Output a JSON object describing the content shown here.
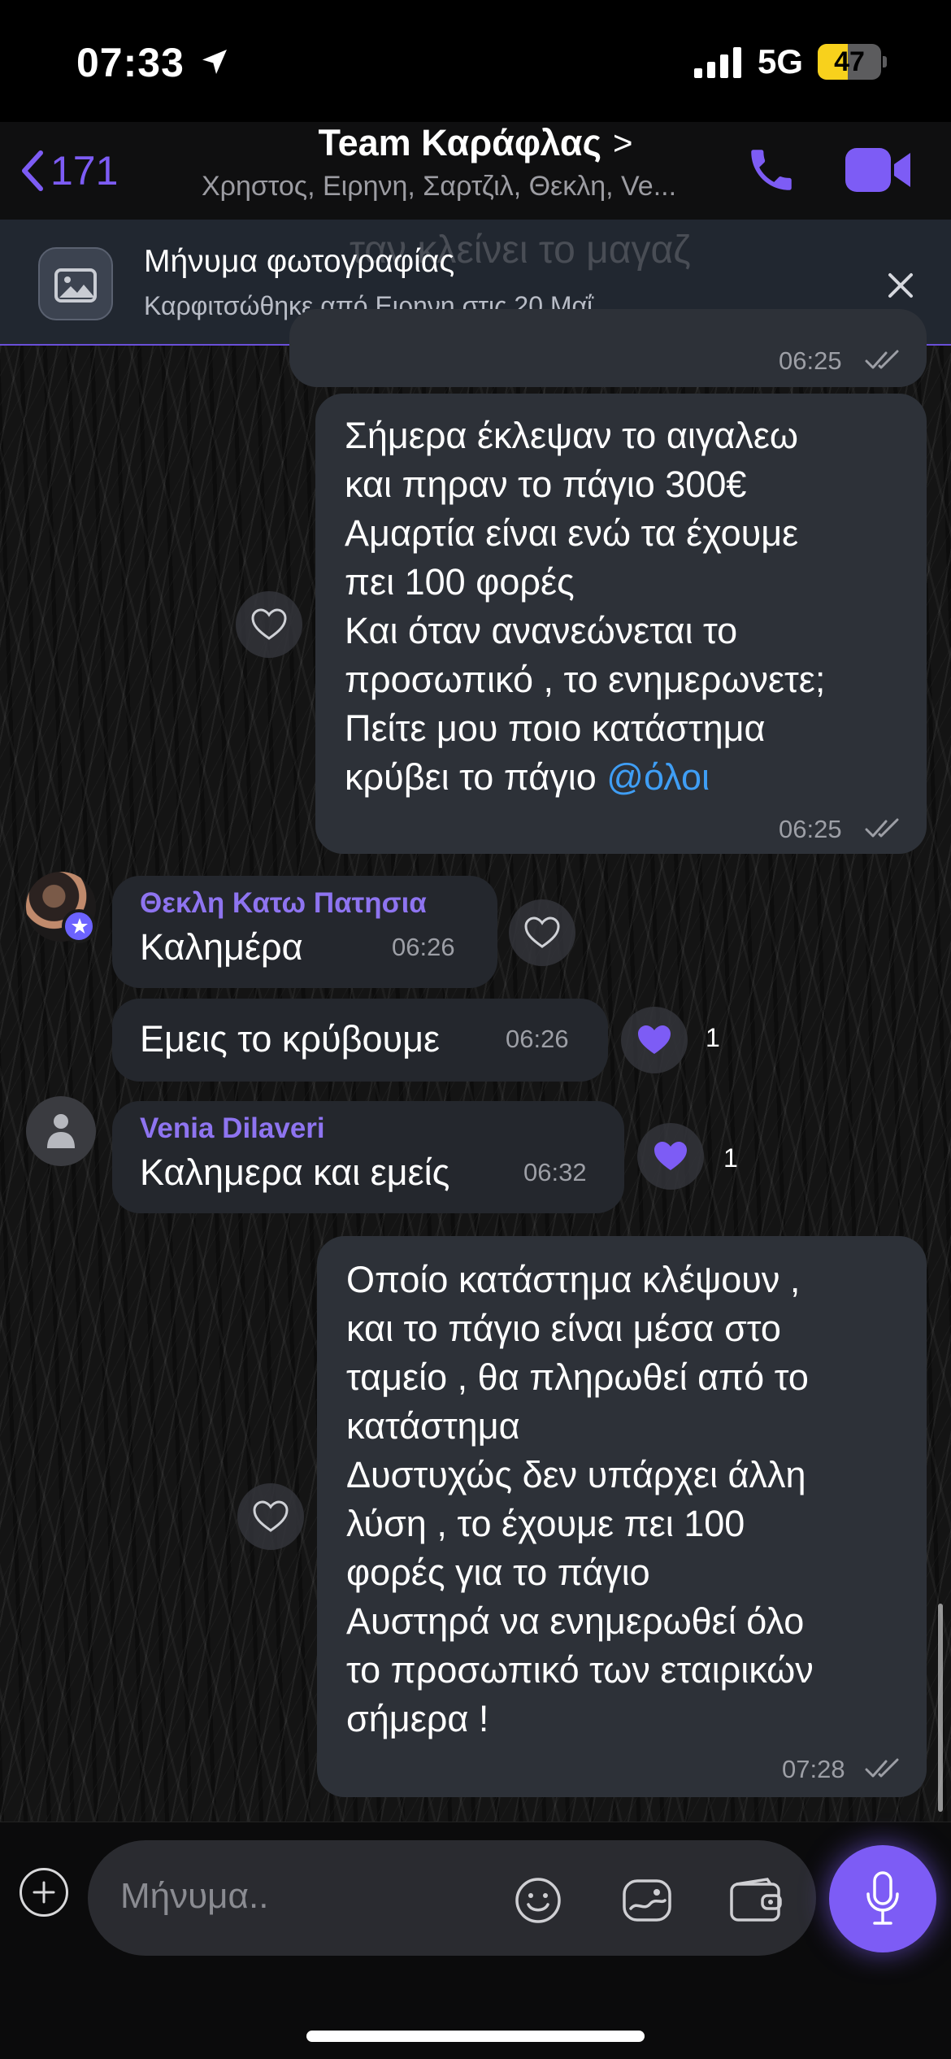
{
  "status_bar": {
    "time": "07:33",
    "network": "5G",
    "battery_percent": "47",
    "battery_level": 0.47
  },
  "header": {
    "back_count": "171",
    "title": "Team Καράφλας",
    "title_chevron": ">",
    "members": "Χρηστος, Ειρηνη, Σαρτζιλ, Θεκλη, Ve..."
  },
  "pinned": {
    "title": "Μήνυμα φωτογραφίας",
    "subtitle": "Καρφιτσώθηκε από Ειρηνη στις 20 Μαΐ",
    "ghost_text": "ταν κλείνει το μαγαζ"
  },
  "messages": [
    {
      "id": "m0",
      "direction": "outgoing",
      "text": "",
      "time": "06:25"
    },
    {
      "id": "m1",
      "direction": "outgoing",
      "text": "Σήμερα έκλεψαν το αιγαλεω\nκαι πηραν το πάγιο 300€\nΑμαρτία είναι ενώ τα έχουμε\nπει 100 φορές\nΚαι όταν ανανεώνεται το\nπροσωπικό , το ενημερωνετε;\nΠείτε μου ποιο κατάστημα\nκρύβει το πάγιο ",
      "mention": "@όλοι",
      "time": "06:25"
    },
    {
      "id": "m2",
      "direction": "incoming",
      "sender": "Θεκλη Κατω Πατησια",
      "text": "Καλημέρα",
      "time": "06:26"
    },
    {
      "id": "m3",
      "direction": "incoming",
      "text": "Εμεις το κρύβουμε",
      "time": "06:26",
      "reactions": "1"
    },
    {
      "id": "m4",
      "direction": "incoming",
      "sender": "Venia Dilaveri",
      "text": "Καλημερα και εμείς",
      "time": "06:32",
      "reactions": "1"
    },
    {
      "id": "m5",
      "direction": "outgoing",
      "text": "Οποίο κατάστημα κλέψουν ,\nκαι το πάγιο είναι μέσα στο\nταμείο , θα πληρωθεί από το\nκατάστημα\nΔυστυχώς δεν υπάρχει άλλη\nλύση , το έχουμε πει 100\nφορές για το πάγιο\nΑυστηρά να ενημερωθεί όλο\nτο προσωπικό των εταιρικών\nσήμερα !",
      "time": "07:28"
    }
  ],
  "composer": {
    "placeholder": "Μήνυμα.."
  },
  "colors": {
    "accent": "#7d5cf5",
    "outgoing_bubble": "#2d3138",
    "incoming_bubble": "#24272d",
    "mention": "#3f9ef5",
    "sender_name": "#8e74f0"
  },
  "icons": [
    "location-arrow-icon",
    "signal-icon",
    "battery-icon",
    "back-chevron-icon",
    "phone-icon",
    "video-camera-icon",
    "image-icon",
    "close-icon",
    "heart-icon",
    "double-check-icon",
    "star-icon",
    "person-icon",
    "plus-icon",
    "emoji-icon",
    "sticker-icon",
    "wallet-icon",
    "microphone-icon"
  ]
}
